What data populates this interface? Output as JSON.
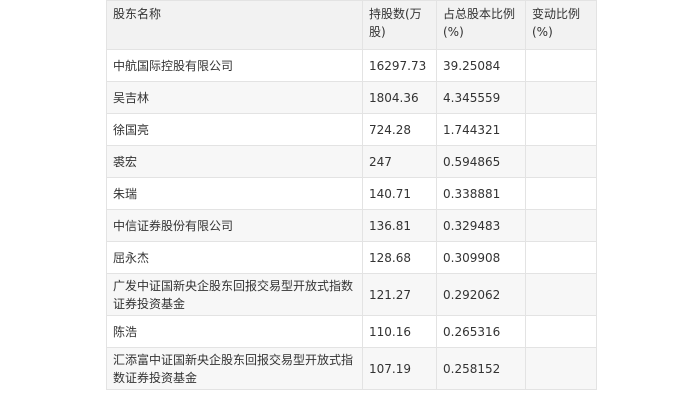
{
  "table": {
    "headers": [
      "股东名称",
      "持股数(万股)",
      "占总股本比例(%)",
      "变动比例(%)"
    ],
    "rows": [
      {
        "name": "中航国际控股有限公司",
        "shares": "16297.73",
        "ratio": "39.25084",
        "change": ""
      },
      {
        "name": "吴吉林",
        "shares": "1804.36",
        "ratio": "4.345559",
        "change": ""
      },
      {
        "name": "徐国亮",
        "shares": "724.28",
        "ratio": "1.744321",
        "change": ""
      },
      {
        "name": "裘宏",
        "shares": "247",
        "ratio": "0.594865",
        "change": ""
      },
      {
        "name": "朱瑞",
        "shares": "140.71",
        "ratio": "0.338881",
        "change": ""
      },
      {
        "name": "中信证券股份有限公司",
        "shares": "136.81",
        "ratio": "0.329483",
        "change": ""
      },
      {
        "name": "屈永杰",
        "shares": "128.68",
        "ratio": "0.309908",
        "change": ""
      },
      {
        "name": "广发中证国新央企股东回报交易型开放式指数证券投资基金",
        "shares": "121.27",
        "ratio": "0.292062",
        "change": ""
      },
      {
        "name": "陈浩",
        "shares": "110.16",
        "ratio": "0.265316",
        "change": ""
      },
      {
        "name": "汇添富中证国新央企股东回报交易型开放式指数证券投资基金",
        "shares": "107.19",
        "ratio": "0.258152",
        "change": ""
      }
    ]
  }
}
